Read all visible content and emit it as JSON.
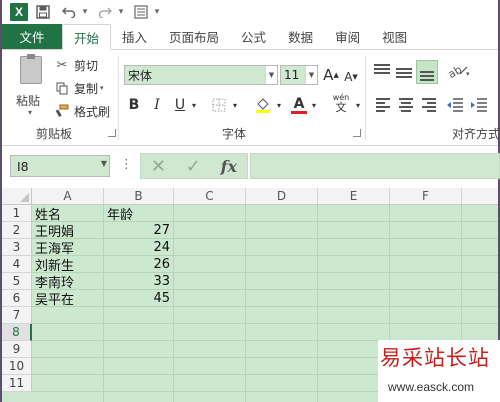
{
  "app": {
    "logo_letter": "X"
  },
  "qat": {
    "dropdown_glyph": "▾"
  },
  "tabs": [
    {
      "label": "文件"
    },
    {
      "label": "开始"
    },
    {
      "label": "插入"
    },
    {
      "label": "页面布局"
    },
    {
      "label": "公式"
    },
    {
      "label": "数据"
    },
    {
      "label": "审阅"
    },
    {
      "label": "视图"
    }
  ],
  "clipboard": {
    "paste_label": "粘贴",
    "cut_label": "剪切",
    "copy_label": "复制",
    "painter_label": "格式刷",
    "group_label": "剪贴板"
  },
  "font": {
    "name": "宋体",
    "size": "11",
    "group_label": "字体",
    "bold": "B",
    "italic": "I",
    "underline": "U",
    "grow": "A",
    "shrink": "A",
    "wen_label": "wén",
    "wen_char": "文"
  },
  "alignment": {
    "group_label": "对齐方式"
  },
  "formula_bar": {
    "name_box": "I8",
    "cancel_glyph": "✕",
    "enter_glyph": "✓",
    "fx_glyph": "fx"
  },
  "sheet": {
    "columns": [
      "A",
      "B",
      "C",
      "D",
      "E",
      "F"
    ],
    "rows": [
      "1",
      "2",
      "3",
      "4",
      "5",
      "6",
      "7",
      "8",
      "9",
      "10",
      "11"
    ],
    "selected_row": "8",
    "cells": {
      "a1": "姓名",
      "b1": "年龄",
      "a2": "王明娟",
      "b2": "27",
      "a3": "王海军",
      "b3": "24",
      "a4": "刘新生",
      "b4": "26",
      "a5": "李南玲",
      "b5": "33",
      "a6": "吴平在",
      "b6": "45"
    }
  },
  "watermark": {
    "title": "易采站长站",
    "url": "www.easck.com"
  },
  "colors": {
    "excel_green": "#217346",
    "sheet_bg": "#cce8cf",
    "watermark_red": "#c8201d"
  }
}
